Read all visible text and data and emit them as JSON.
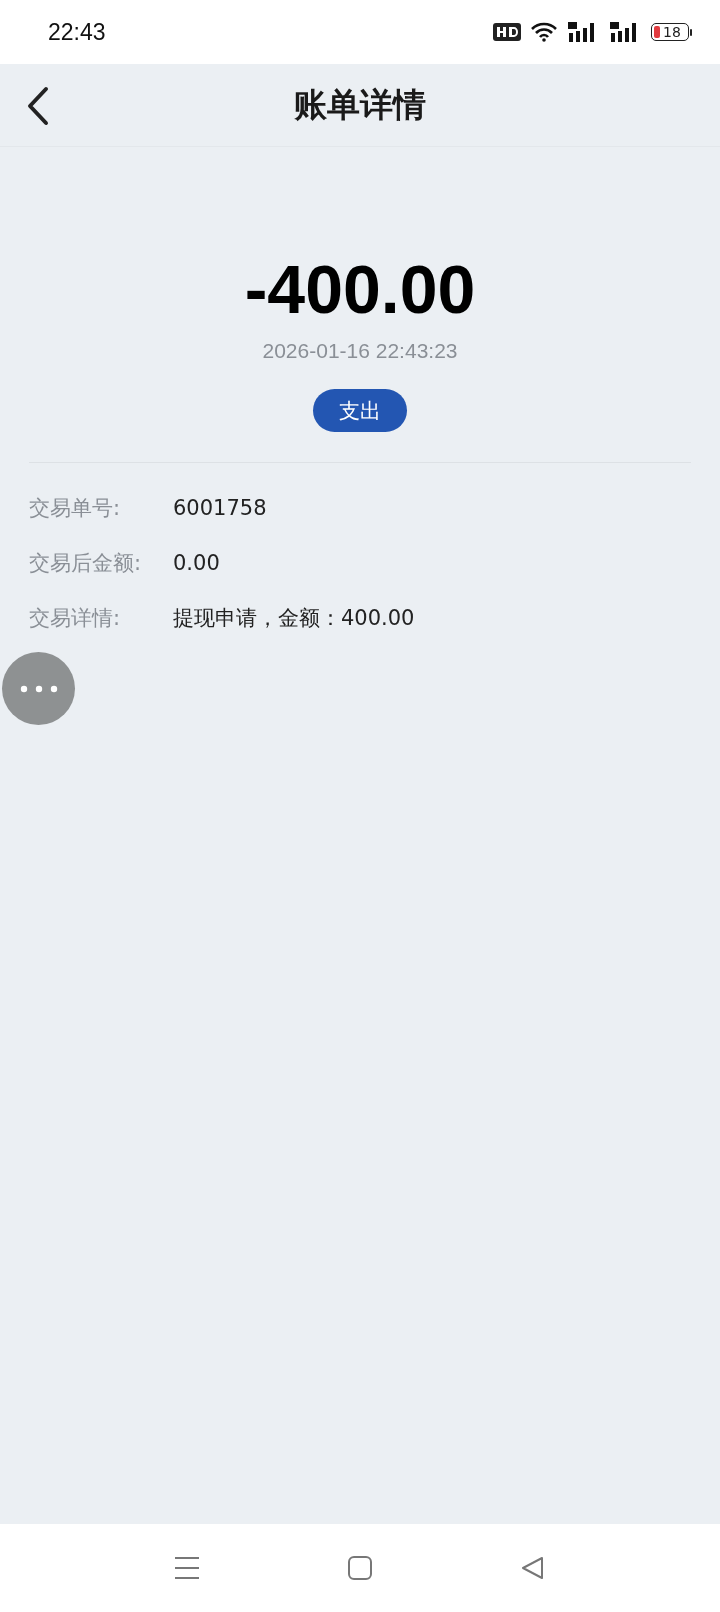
{
  "status_bar": {
    "time": "22:43",
    "battery": "18"
  },
  "header": {
    "title": "账单详情"
  },
  "amount": "-400.00",
  "datetime": "2026-01-16 22:43:23",
  "badge": "支出",
  "details": [
    {
      "label": "交易单号:",
      "value": "6001758"
    },
    {
      "label": "交易后金额:",
      "value": "0.00"
    },
    {
      "label": "交易详情:",
      "value": "提现申请，金额：400.00"
    }
  ]
}
